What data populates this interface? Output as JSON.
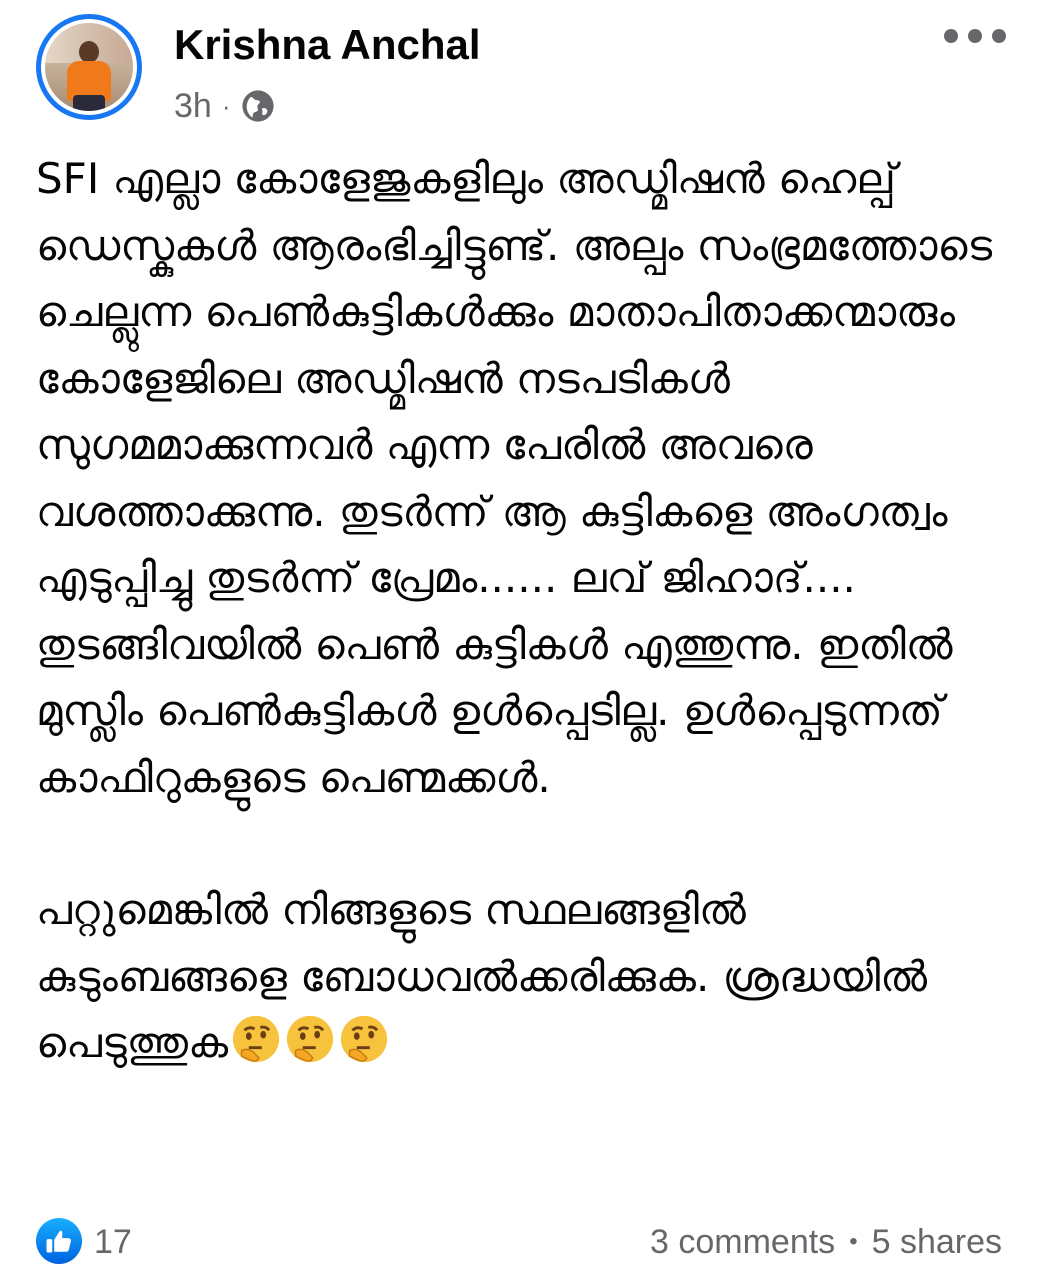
{
  "post": {
    "author": "Krishna Anchal",
    "time": "3h",
    "separator": "·",
    "audience_icon": "globe-icon",
    "more_icon": "more-options-icon",
    "paragraphs": [
      "SFI എല്ലാ കോളേജുകളിലും അഡ്മിഷൻ ഹെല്പ് ഡെസ്കുകൾ ആരംഭിച്ചിട്ടുണ്ട്. അല്പം സംഭ്രമത്തോടെ ചെല്ലുന്ന പെൺകുട്ടികൾക്കും മാതാപിതാക്കന്മാരും കോളേജിലെ അഡ്മിഷൻ നടപടികൾ സുഗമമാക്കുന്നവർ എന്ന പേരിൽ അവരെ വശത്താക്കുന്നു. തുടർന്ന് ആ കുട്ടികളെ അംഗത്വം എടുപ്പിച്ചു തുടർന്ന് പ്രേമം...... ലവ് ജിഹാദ്.... തുടങ്ങിവയിൽ പെൺ കുട്ടികൾ എത്തുന്നു. ഇതിൽ മുസ്ലിം പെൺകുട്ടികൾ ഉൾപ്പെടില്ല. ഉൾപ്പെടുന്നത് കാഫിറുകളുടെ പെണ്മക്കൾ.",
      "പറ്റുമെങ്കിൽ നിങ്ങളുടെ സ്ഥലങ്ങളിൽ കുടുംബങ്ങളെ ബോധവൽക്കരിക്കുക. ശ്രദ്ധയിൽ പെടുത്തുക"
    ],
    "emojis": [
      "thinking-face-icon",
      "thinking-face-icon",
      "thinking-face-icon"
    ]
  },
  "footer": {
    "like_icon": "like-thumb-icon",
    "like_count": "17",
    "comments": "3 comments",
    "bullet": "•",
    "shares": "5 shares"
  },
  "colors": {
    "brand_blue": "#1877f2",
    "secondary_text": "#65676b",
    "primary_text": "#050505"
  }
}
